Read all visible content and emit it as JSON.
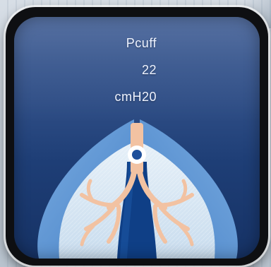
{
  "parameter": {
    "name": "Pcuff",
    "value": "22",
    "unit": "cmH20"
  },
  "colors": {
    "tile_frame": "#0e0f12",
    "screen_top": "#3f5d95",
    "screen_bottom": "#163265",
    "lung_light": "#6fa6de",
    "lung_mid": "#3a78c2",
    "lung_pale": "#cfe2f2",
    "trachea_bronchi": "#f2c2a2",
    "airway_center": "#0f3f86",
    "text": "#eef3ff"
  },
  "icons": {
    "graphic": "lungs-icon"
  }
}
